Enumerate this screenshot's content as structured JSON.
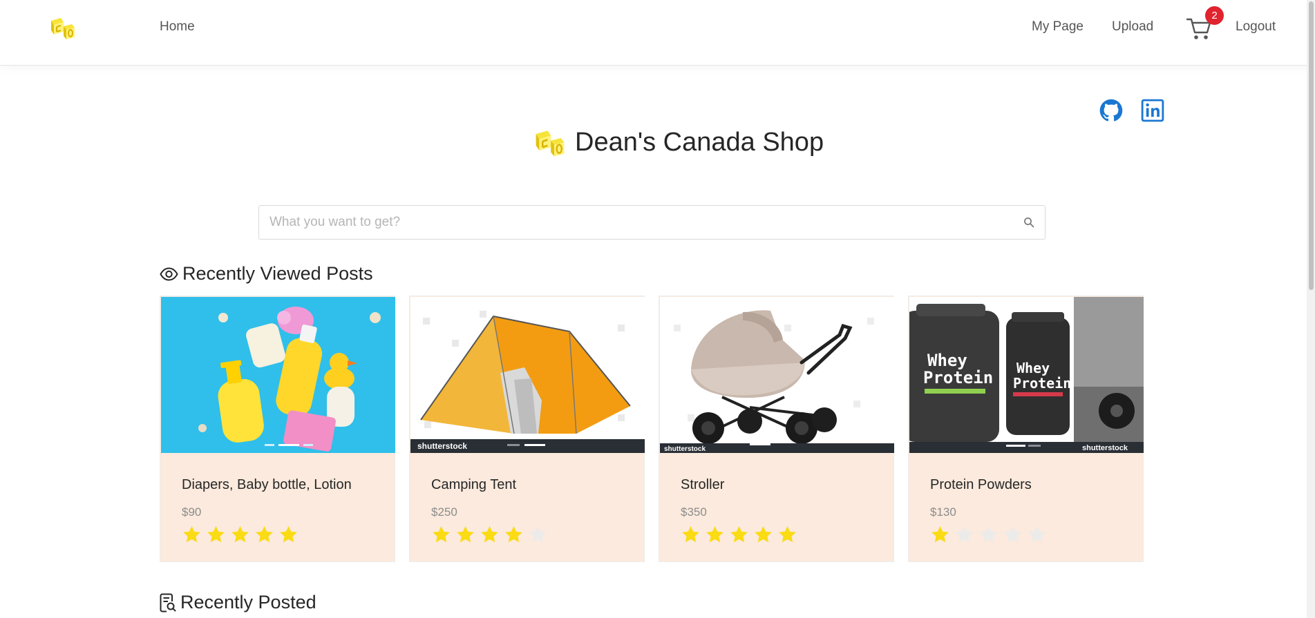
{
  "nav": {
    "home": "Home",
    "my_page": "My Page",
    "upload": "Upload",
    "logout": "Logout",
    "cart_count": "2"
  },
  "site": {
    "title": "Dean's Canada Shop"
  },
  "search": {
    "placeholder": "What you want to get?",
    "value": ""
  },
  "sections": {
    "recent_viewed": "Recently Viewed Posts",
    "recent_posted": "Recently Posted"
  },
  "products": [
    {
      "title": "Diapers, Baby bottle, Lotion",
      "price": "$90",
      "rating": 5
    },
    {
      "title": "Camping Tent",
      "price": "$250",
      "rating": 4
    },
    {
      "title": "Stroller",
      "price": "$350",
      "rating": 5
    },
    {
      "title": "Protein Powders",
      "price": "$130",
      "rating": 1
    }
  ],
  "image_text": {
    "watermark": "shutterstock",
    "whey_line1": "Whey",
    "whey_line2": "Protein"
  },
  "colors": {
    "card_bg": "#fbeadd",
    "star_on": "#fadb14",
    "star_off": "#ebebeb",
    "badge": "#e0232e",
    "social": "#1a77d2"
  },
  "icons": {
    "logo": "cube-logo-icon",
    "cart": "shopping-cart-icon",
    "github": "github-icon",
    "linkedin": "linkedin-icon",
    "search": "search-icon",
    "eye": "eye-icon",
    "posted": "file-search-icon",
    "star": "star-icon"
  }
}
